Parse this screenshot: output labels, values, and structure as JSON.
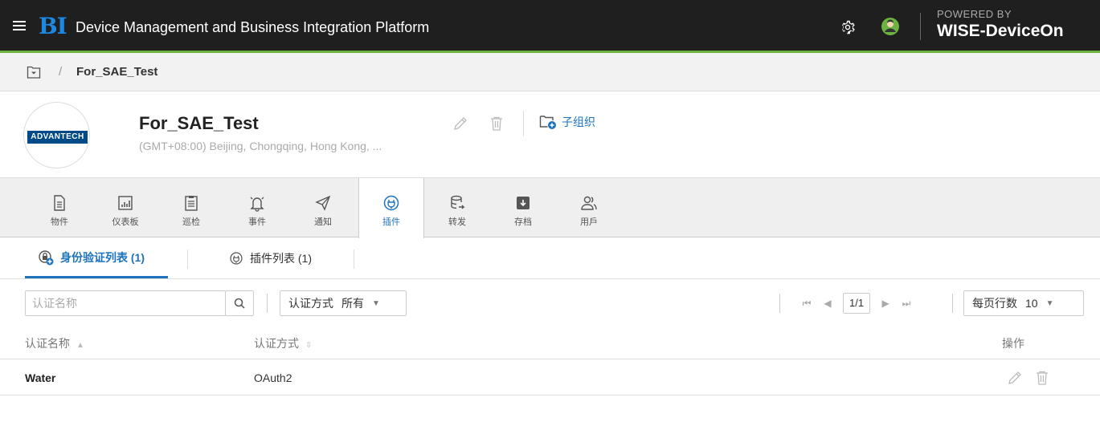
{
  "header": {
    "logo": "BI",
    "title": "Device Management and Business Integration Platform",
    "powered_by": "POWERED BY",
    "brand": "WISE-DeviceOn"
  },
  "breadcrumb": {
    "separator": "/",
    "current": "For_SAE_Test"
  },
  "org": {
    "logo_text": "ADVANTECH",
    "name": "For_SAE_Test",
    "timezone": "(GMT+08:00) Beijing, Chongqing, Hong Kong, ...",
    "sub_org_label": "子组织"
  },
  "module_tabs": [
    {
      "label": "物件",
      "icon": "document-icon"
    },
    {
      "label": "仪表板",
      "icon": "dashboard-icon"
    },
    {
      "label": "巡检",
      "icon": "checklist-icon"
    },
    {
      "label": "事件",
      "icon": "bell-icon"
    },
    {
      "label": "通知",
      "icon": "send-icon"
    },
    {
      "label": "插件",
      "icon": "plug-icon",
      "active": true
    },
    {
      "label": "转发",
      "icon": "database-forward-icon"
    },
    {
      "label": "存档",
      "icon": "archive-icon"
    },
    {
      "label": "用戶",
      "icon": "users-icon"
    }
  ],
  "sub_tabs": [
    {
      "label": "身份验证列表 (1)",
      "active": true
    },
    {
      "label": "插件列表 (1)"
    }
  ],
  "filters": {
    "search_placeholder": "认证名称",
    "auth_method_label": "认证方式",
    "auth_method_value": "所有",
    "rows_per_page_label": "每页行数",
    "rows_per_page_value": "10"
  },
  "pager": {
    "page": "1/1"
  },
  "table": {
    "columns": [
      "认证名称",
      "认证方式",
      "操作"
    ],
    "rows": [
      {
        "name": "Water",
        "method": "OAuth2"
      }
    ]
  },
  "colors": {
    "accent": "#1e73be",
    "topbar": "#1f1f1f",
    "green_line": "#6cb33f"
  }
}
